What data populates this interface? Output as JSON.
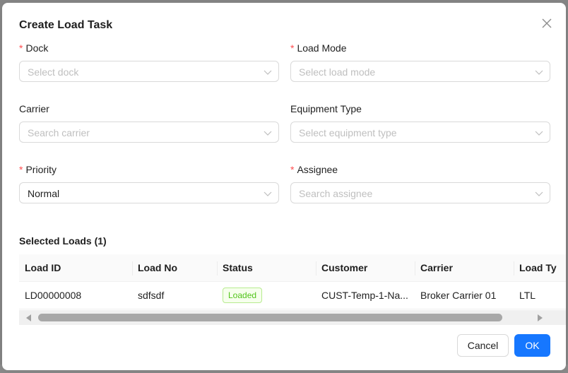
{
  "dialog": {
    "title": "Create Load Task",
    "close_label": "×"
  },
  "form": {
    "dock": {
      "label": "Dock",
      "required": "*",
      "placeholder": "Select dock"
    },
    "load_mode": {
      "label": "Load Mode",
      "required": "*",
      "placeholder": "Select load mode"
    },
    "carrier": {
      "label": "Carrier",
      "placeholder": "Search carrier"
    },
    "equipment_type": {
      "label": "Equipment Type",
      "placeholder": "Select equipment type"
    },
    "priority": {
      "label": "Priority",
      "required": "*",
      "value": "Normal"
    },
    "assignee": {
      "label": "Assignee",
      "required": "*",
      "placeholder": "Search assignee"
    }
  },
  "selected_loads": {
    "title": "Selected Loads (1)",
    "columns": [
      "Load ID",
      "Load No",
      "Status",
      "Customer",
      "Carrier",
      "Load Ty"
    ],
    "rows": [
      {
        "load_id": "LD00000008",
        "load_no": "sdfsdf",
        "status": "Loaded",
        "customer": "CUST-Temp-1-Na...",
        "carrier": "Broker Carrier 01",
        "load_type": "LTL"
      }
    ]
  },
  "footer": {
    "cancel_label": "Cancel",
    "ok_label": "OK"
  },
  "colors": {
    "primary": "#1677ff",
    "required": "#ff4d4f",
    "status_loaded": "#52c41a"
  },
  "icons": {
    "close": "close-icon",
    "dropdown": "chevron-down-icon"
  }
}
